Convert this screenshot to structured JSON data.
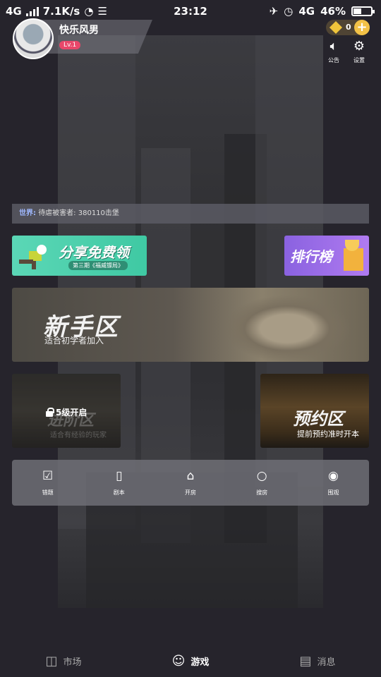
{
  "status_bar": {
    "network": "4G",
    "speed": "7.1K/s",
    "time": "23:12",
    "network_right": "4G",
    "battery": "46%",
    "battery_level": 0.46
  },
  "profile": {
    "username": "快乐风男",
    "level": "Lv.1"
  },
  "currency": {
    "gem_count": "0",
    "plus": "+"
  },
  "top_actions": [
    {
      "icon": "speaker-icon",
      "label": "公告"
    },
    {
      "icon": "gear-icon",
      "label": "设置"
    }
  ],
  "ticker": {
    "label": "世界:",
    "text": "待虐被害者: 380110击堡"
  },
  "banners": {
    "share": {
      "title": "分享免费领",
      "subtitle": "第三期《福威镖局》"
    },
    "rank": {
      "title": "排行榜"
    },
    "newbie": {
      "title": "新手区",
      "subtitle": "适合初学者加入"
    },
    "advanced": {
      "title": "进阶区",
      "subtitle": "适合有经验的玩家",
      "lock": "5级开启"
    },
    "reserve": {
      "title": "预约区",
      "subtitle": "提前预约准时开本"
    }
  },
  "menu": [
    {
      "icon": "checkin-icon",
      "label": "错题"
    },
    {
      "icon": "book-icon",
      "label": "剧本"
    },
    {
      "icon": "home-icon",
      "label": "开房"
    },
    {
      "icon": "search-icon",
      "label": "搜房"
    },
    {
      "icon": "eye-icon",
      "label": "围观"
    }
  ],
  "bottom_nav": [
    {
      "icon": "book-open-icon",
      "label": "市场"
    },
    {
      "icon": "robot-icon",
      "label": "游戏"
    },
    {
      "icon": "chat-icon",
      "label": "消息"
    }
  ]
}
